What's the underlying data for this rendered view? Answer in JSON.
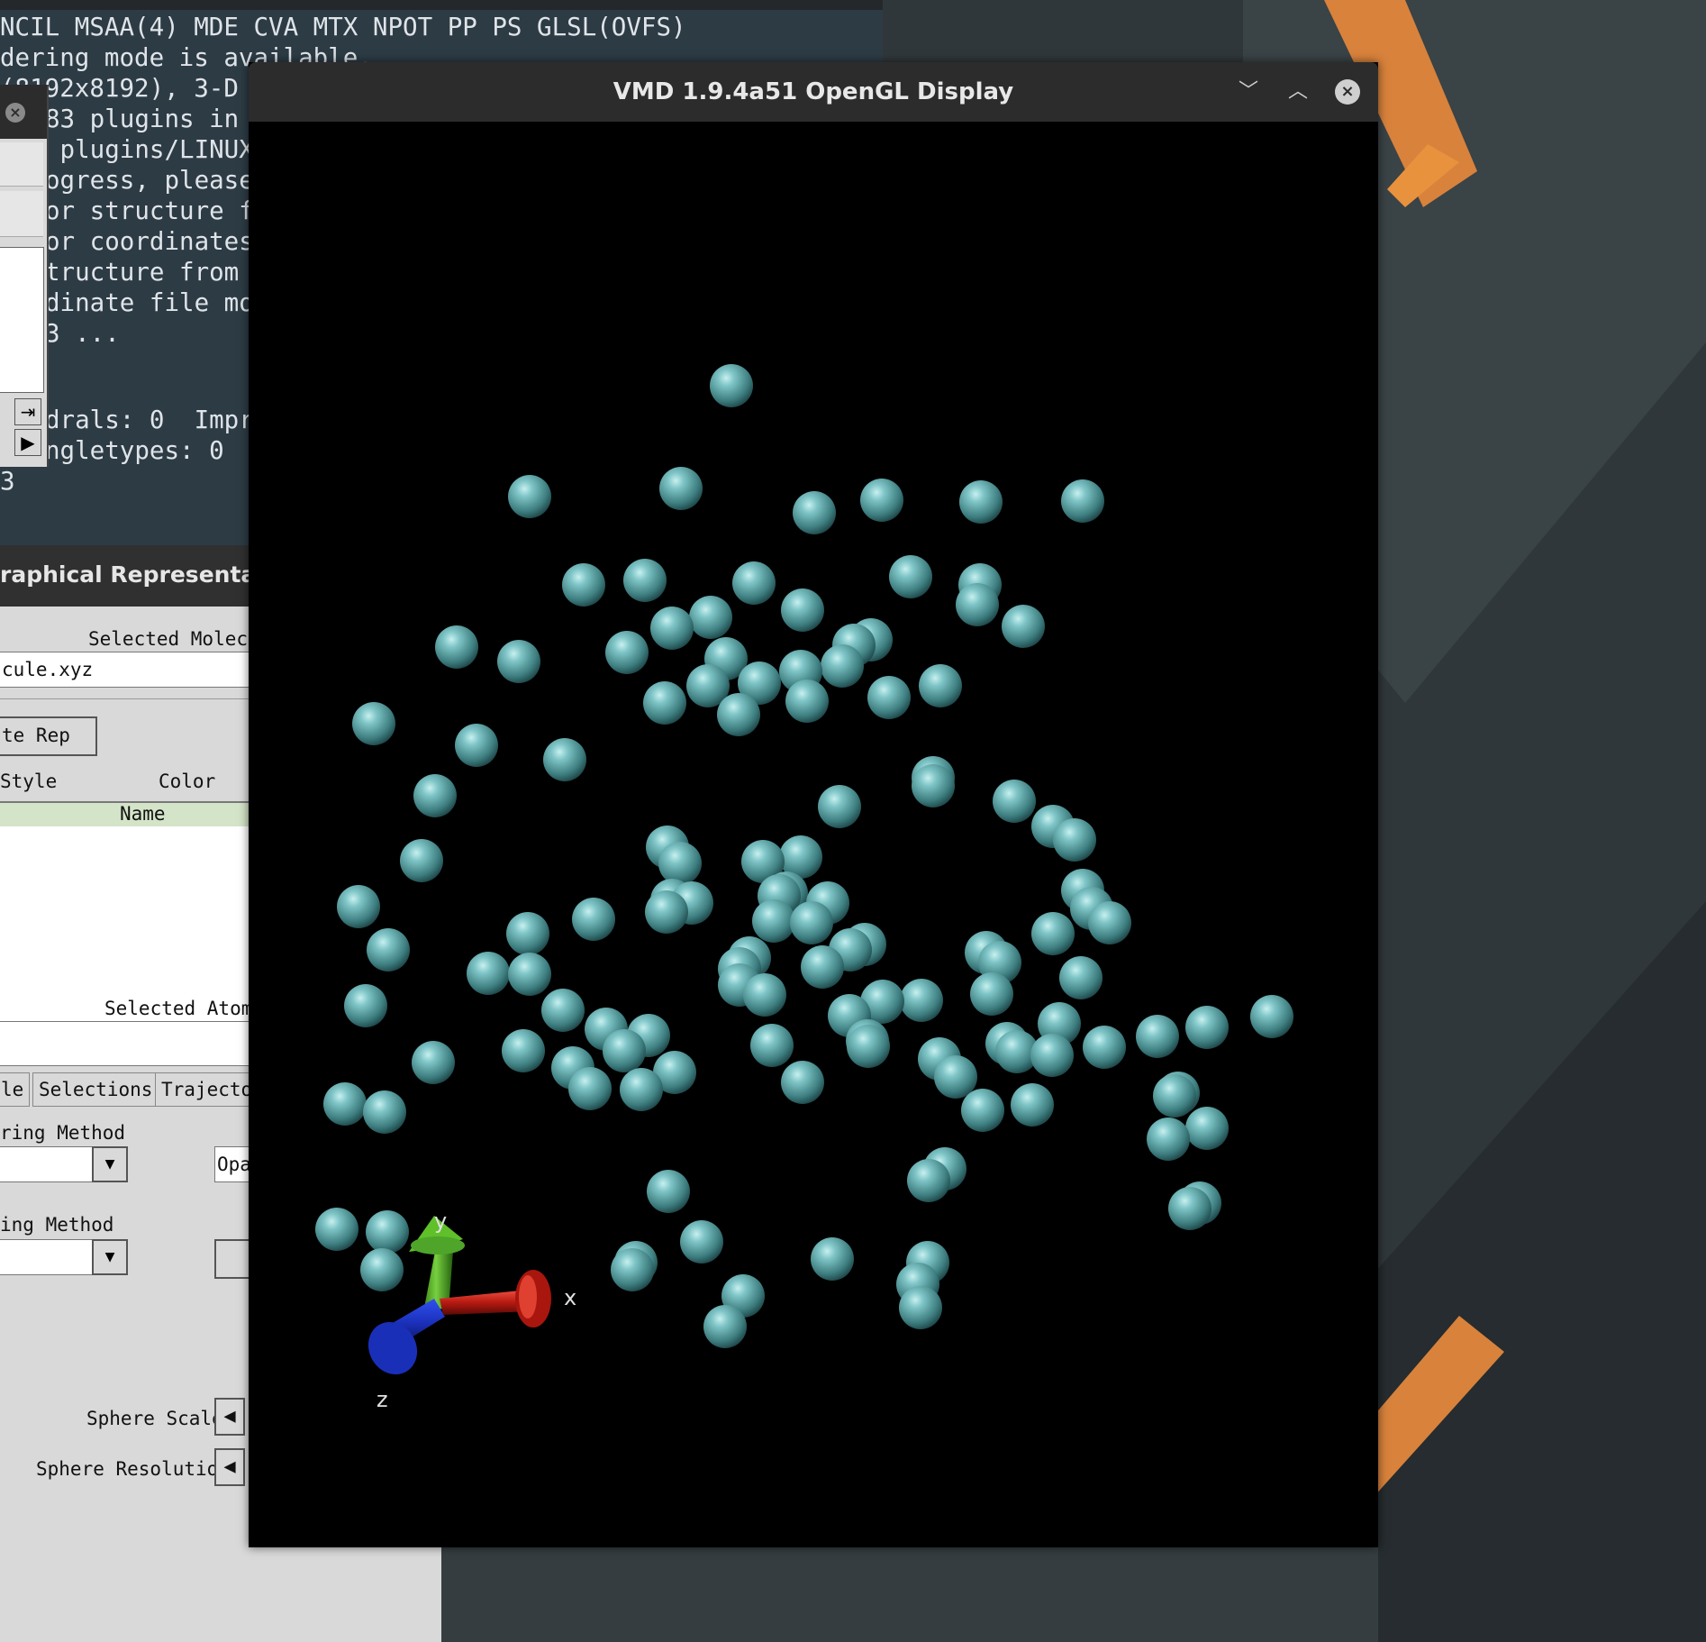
{
  "terminal": {
    "lines": [
      "NCIL MSAA(4) MDE CVA MTX NPOT PP PS GLSL(OVFS)",
      "dering mode is available.",
      "(8192x8192), 3-D",
      "83 plugins in",
      " plugins/LINUX",
      "ogress, please",
      "or structure f",
      "or coordinates",
      "tructure from",
      "dinate file mo",
      "3 ...",
      "",
      "drals: 0  Impr",
      "ngletypes: 0",
      "3"
    ]
  },
  "graph_reps": {
    "title": "raphical Representati",
    "selected_molecule_label": "Selected Molecul",
    "molecule_value": "cule.xyz",
    "create_rep_label": "te Rep",
    "col_style": "Style",
    "col_color": "Color",
    "row_name": "Name",
    "selected_atoms_label": "Selected Atoms",
    "tabs": [
      "le",
      "Selections",
      "Trajector"
    ],
    "coloring_method_label": "ring Method",
    "material_value": "Opa",
    "drawing_method_label": "ing Method",
    "sphere_scale_label": "Sphere Scale",
    "sphere_resolution_label": "Sphere Resolution"
  },
  "gl_window": {
    "title": "VMD 1.9.4a51 OpenGL Display",
    "minimize_icon": "chevron-down-icon",
    "maximize_icon": "chevron-up-icon",
    "close_icon": "close-icon",
    "atom_color": "#5aa6a8",
    "axes": {
      "x_label": "x",
      "y_label": "y",
      "z_label": "z",
      "x_color": "#c8201a",
      "y_color": "#3c9a1c",
      "z_color": "#1a2fb8"
    }
  }
}
